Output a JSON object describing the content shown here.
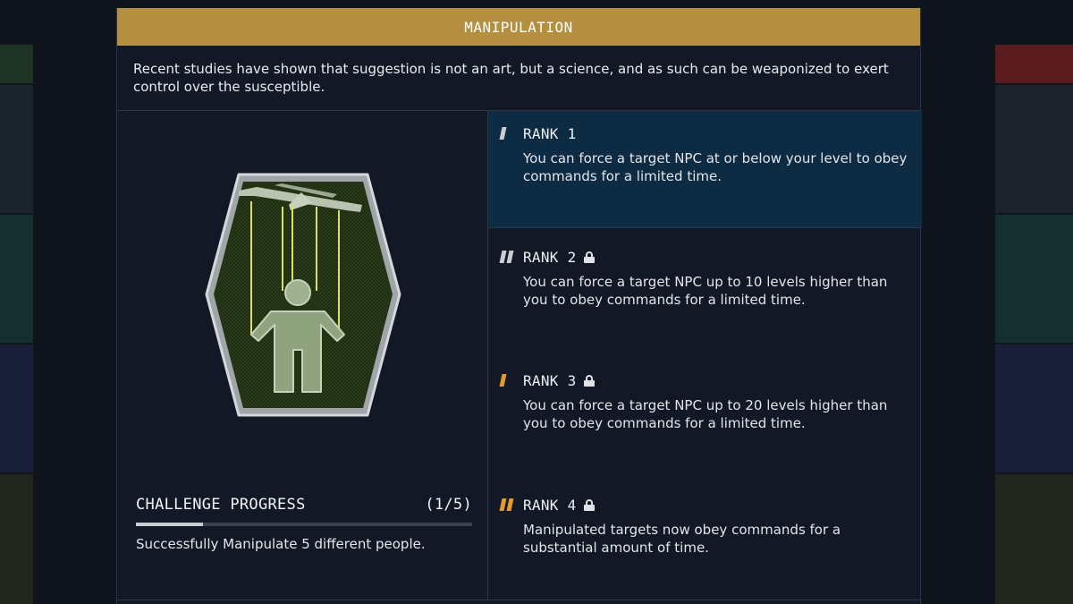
{
  "window": {
    "title": "MANIPULATION"
  },
  "description": "Recent studies have shown that suggestion is not an art, but a science, and as such can be weaponized to exert control over the susceptible.",
  "badge": {
    "icon": "marionette-puppet-icon"
  },
  "challenge": {
    "title": "CHALLENGE PROGRESS",
    "count": "(1/5)",
    "progress": 0.2,
    "description": "Successfully Manipulate 5 different people."
  },
  "ranks": [
    {
      "label": "RANK 1",
      "locked": false,
      "active": true,
      "color": "#c9ccd3",
      "bars": 1,
      "description": "You can force a target NPC at or below your level to obey commands for a limited time."
    },
    {
      "label": "RANK 2",
      "locked": true,
      "active": false,
      "color": "#c9ccd3",
      "bars": 2,
      "description": "You can force a target NPC up to 10 levels higher than you to obey commands for a limited time."
    },
    {
      "label": "RANK 3",
      "locked": true,
      "active": false,
      "color": "#e39a2a",
      "bars": 1,
      "description": "You can force a target NPC up to 20 levels higher than you to obey commands for a limited time."
    },
    {
      "label": "RANK 4",
      "locked": true,
      "active": false,
      "color": "#e39a2a",
      "bars": 2,
      "description": "Manipulated targets now obey commands for a substantial amount of time."
    }
  ],
  "colors": {
    "header": "#b38f3f",
    "active_rank": "#0d2b42",
    "panel": "#121826"
  }
}
